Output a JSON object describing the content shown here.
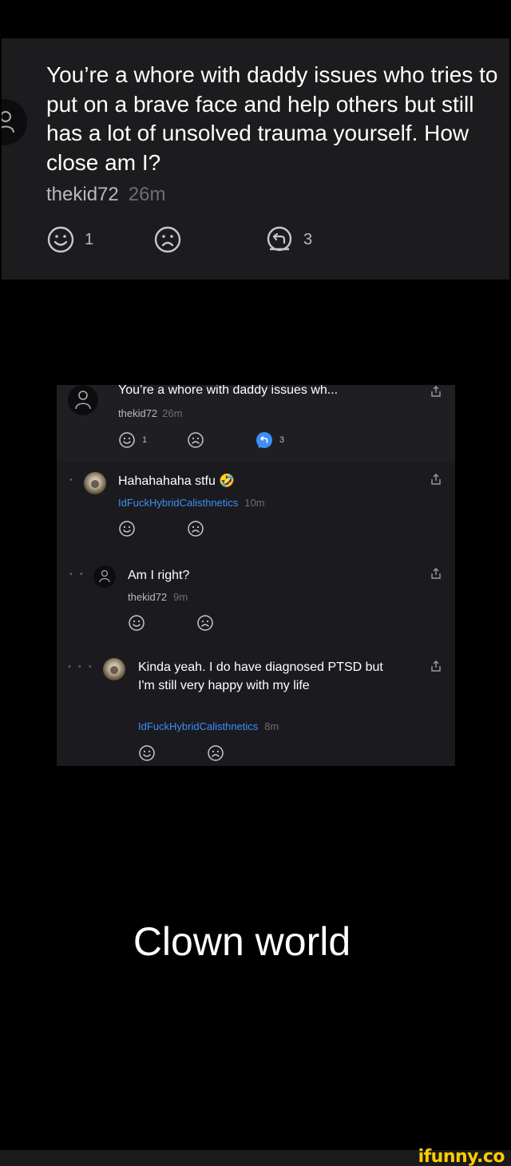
{
  "top_comment": {
    "text": "You’re a whore with daddy issues who tries to put on a brave face and help others but still has a lot of unsolved trauma yourself. How close am I?",
    "username": "thekid72",
    "time": "26m",
    "smile_count": "1",
    "replies_count": "3"
  },
  "screenshot": {
    "op": {
      "text": "You’re a whore with daddy issues wh...",
      "username": "thekid72",
      "time": "26m",
      "smile_count": "1",
      "replies_count": "3"
    },
    "replies": [
      {
        "depth_dots": "•",
        "text": "Hahahahaha stfu 🤣",
        "username": "IdFuckHybridCalisthnetics",
        "time": "10m"
      },
      {
        "depth_dots": "• •",
        "text": "Am I right?",
        "username": "thekid72",
        "time": "9m"
      },
      {
        "depth_dots": "• • •",
        "text": "Kinda yeah. I do have diagnosed PTSD but I'm still very happy with my life",
        "username": "IdFuckHybridCalisthnetics",
        "time": "8m"
      }
    ]
  },
  "caption": "Clown world",
  "watermark": "ifunny.co",
  "colors": {
    "username_blue": "#3d8ef7",
    "reply_badge": "#3d8ef7",
    "watermark": "#ffcc00"
  }
}
